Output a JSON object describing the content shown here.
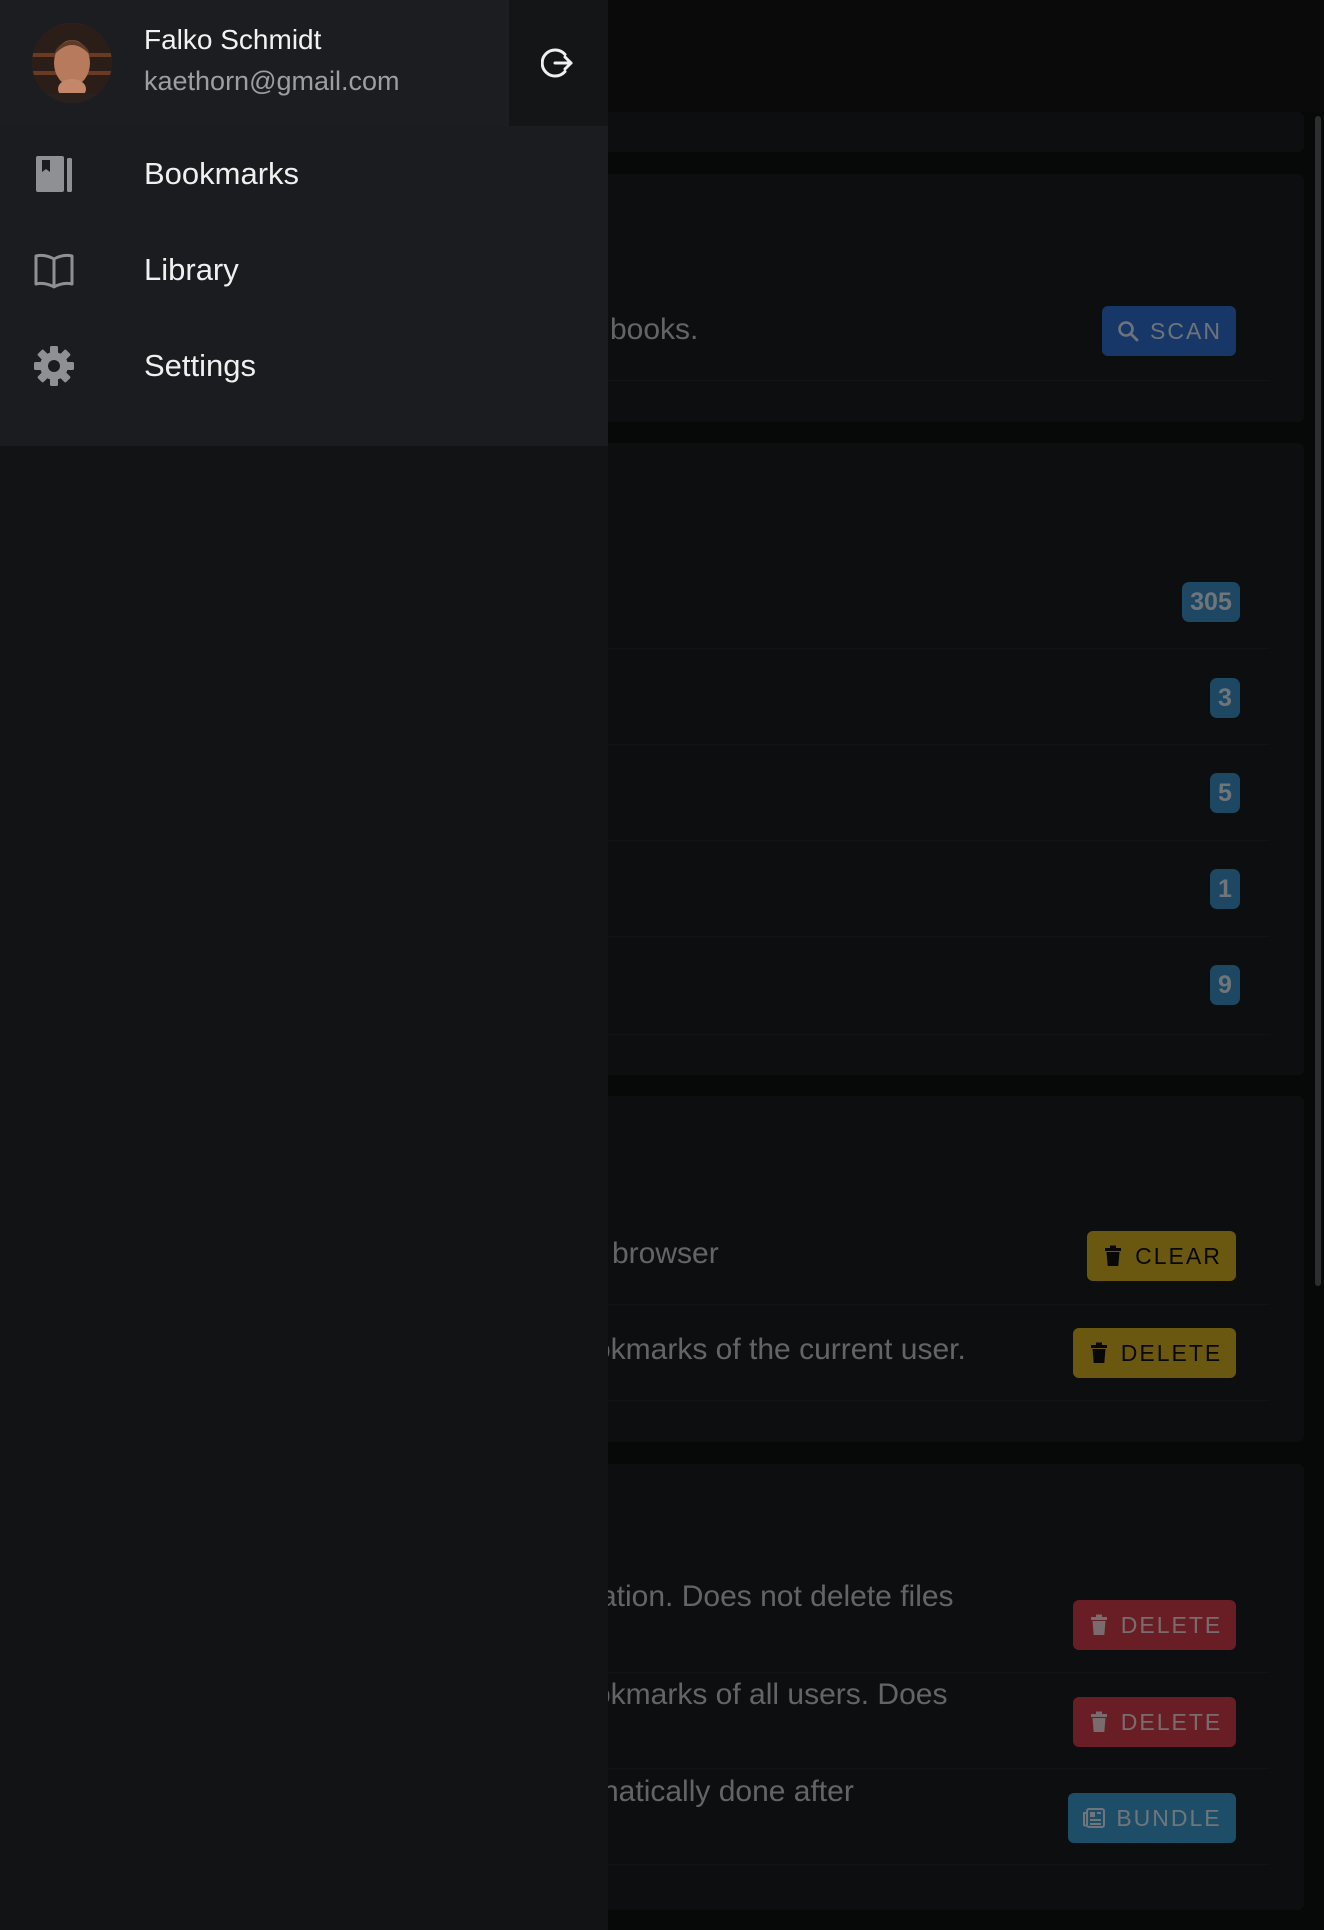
{
  "drawer": {
    "user": {
      "name": "Falko Schmidt",
      "email": "kaethorn@gmail.com"
    },
    "nav": [
      {
        "label": "Bookmarks",
        "icon": "bookmark-book-icon"
      },
      {
        "label": "Library",
        "icon": "open-book-icon"
      },
      {
        "label": "Settings",
        "icon": "gear-icon"
      }
    ],
    "logout_icon": "logout-icon"
  },
  "background": {
    "library_section": {
      "scan_text": "books.",
      "scan_button": "SCAN"
    },
    "stats_section": {
      "counts": [
        "305",
        "3",
        "5",
        "1",
        "9"
      ]
    },
    "user_data_section": {
      "clear_text": "browser",
      "clear_button": "CLEAR",
      "delete_bookmarks_text": "okmarks of the current user.",
      "delete_button": "DELETE"
    },
    "admin_section": {
      "delete_library_text": "ation. Does not delete files",
      "delete_library_button": "DELETE",
      "delete_all_bookmarks_text": "okmarks of all users. Does",
      "delete_all_bookmarks_button": "DELETE",
      "bundle_text": "natically done after",
      "bundle_button": "BUNDLE"
    }
  },
  "colors": {
    "primary": "#2f6fd0",
    "warning": "#d4b120",
    "danger": "#d23b4a",
    "info": "#3d9ad0"
  }
}
